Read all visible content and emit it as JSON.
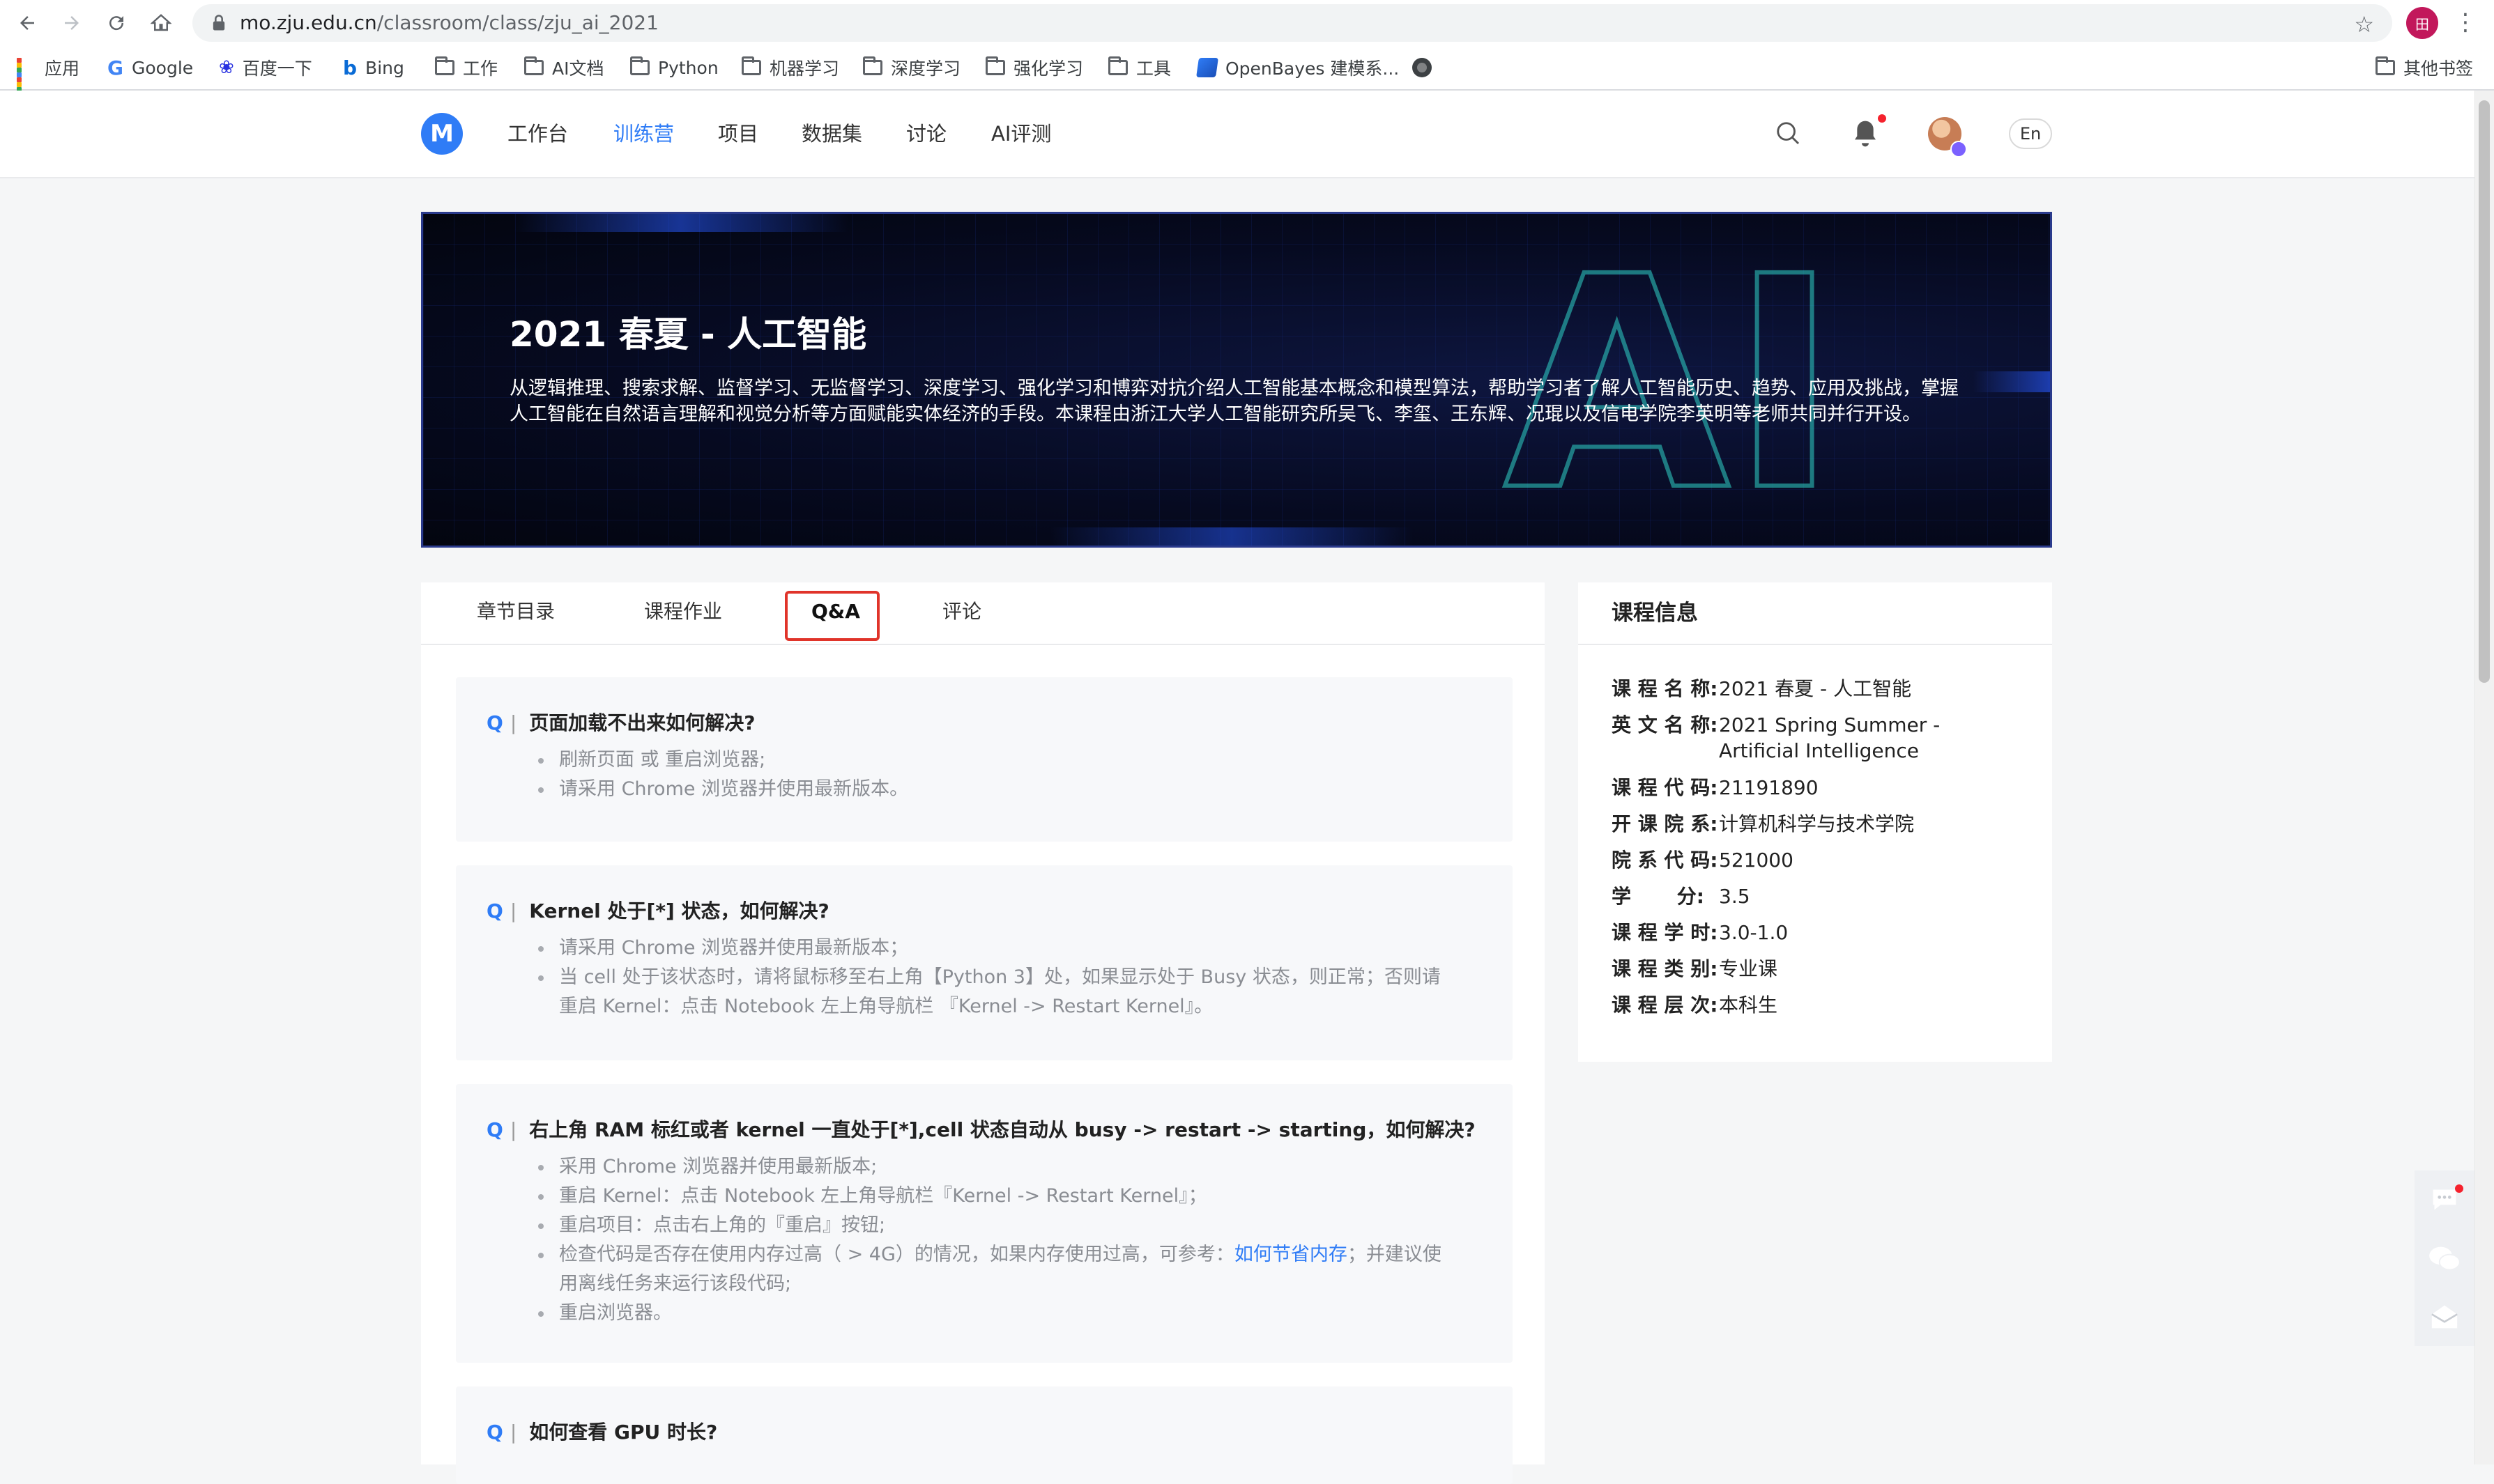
{
  "browser": {
    "url_host": "mo.zju.edu.cn",
    "url_path": "/classroom/class/zju_ai_2021",
    "profile_initial": "田",
    "bookmarks": [
      "应用",
      "Google",
      "百度一下",
      "Bing",
      "工作",
      "AI文档",
      "Python",
      "机器学习",
      "深度学习",
      "强化学习",
      "工具",
      "OpenBayes 建模系...",
      "其他书签"
    ]
  },
  "header": {
    "logo_letter": "M",
    "nav": [
      "工作台",
      "训练营",
      "项目",
      "数据集",
      "讨论",
      "AI评测"
    ],
    "active_nav": "训练营",
    "lang": "En"
  },
  "banner": {
    "title": "2021 春夏 - 人工智能",
    "description": "从逻辑推理、搜索求解、监督学习、无监督学习、深度学习、强化学习和博弈对抗介绍人工智能基本概念和模型算法，帮助学习者了解人工智能历史、趋势、应用及挑战，掌握人工智能在自然语言理解和视觉分析等方面赋能实体经济的手段。本课程由浙江大学人工智能研究所吴飞、李玺、王东辉、况琨以及信电学院李英明等老师共同并行开设。",
    "art_text": "AI"
  },
  "tabs": [
    "章节目录",
    "课程作业",
    "Q&A",
    "评论"
  ],
  "active_tab": "Q&A",
  "qa": {
    "q_marker": "Q",
    "sep": "|",
    "items": [
      {
        "q": "页面加载不出来如何解决?",
        "a": [
          "刷新页面 或 重启浏览器;",
          "请采用 Chrome 浏览器并使用最新版本。"
        ]
      },
      {
        "q": "Kernel 处于[*] 状态，如何解决?",
        "a": [
          "请采用 Chrome 浏览器并使用最新版本；",
          "当 cell 处于该状态时，请将鼠标移至右上角【Python 3】处，如果显示处于 Busy 状态，则正常；否则请",
          "重启 Kernel：点击 Notebook 左上角导航栏 『Kernel -> Restart Kernel』。"
        ]
      },
      {
        "q": "右上角 RAM 标红或者 kernel 一直处于[*],cell 状态自动从 busy -> restart -> starting，如何解决?",
        "a": [
          "采用 Chrome 浏览器并使用最新版本;",
          "重启 Kernel：点击 Notebook 左上角导航栏『Kernel -> Restart Kernel』；",
          "重启项目：点击右上角的『重启』按钮;",
          "检查代码是否存在使用内存过高（ > 4G）的情况，如果内存使用过高，可参考：",
          "如何节省内存",
          "；并建议使",
          "用离线任务来运行该段代码;",
          "重启浏览器。"
        ]
      },
      {
        "q": "如何查看 GPU 时长?"
      }
    ]
  },
  "course_info": {
    "title": "课程信息",
    "rows": [
      {
        "k": "课 程 名 称:",
        "v": "2021 春夏 - 人工智能"
      },
      {
        "k": "英 文 名 称:",
        "v": "2021 Spring Summer - Artificial Intelligence"
      },
      {
        "k": "课 程 代 码:",
        "v": "21191890"
      },
      {
        "k": "开 课 院 系:",
        "v": "计算机科学与技术学院"
      },
      {
        "k": "院 系 代 码:",
        "v": "521000"
      },
      {
        "k": "学　　 分:",
        "v": "3.5"
      },
      {
        "k": "课 程 学 时:",
        "v": "3.0-1.0"
      },
      {
        "k": "课 程 类 别:",
        "v": "专业课"
      },
      {
        "k": "课 程 层 次:",
        "v": "本科生"
      }
    ]
  },
  "colors": {
    "accent": "#2f7cf6",
    "highlight": "#e0342a",
    "banner_bg": "#060a20"
  },
  "icons": [
    "back-icon",
    "forward-icon",
    "reload-icon",
    "home-icon",
    "lock-icon",
    "star-icon",
    "search-icon",
    "bell-icon",
    "chat-icon",
    "wechat-icon",
    "mail-icon"
  ]
}
